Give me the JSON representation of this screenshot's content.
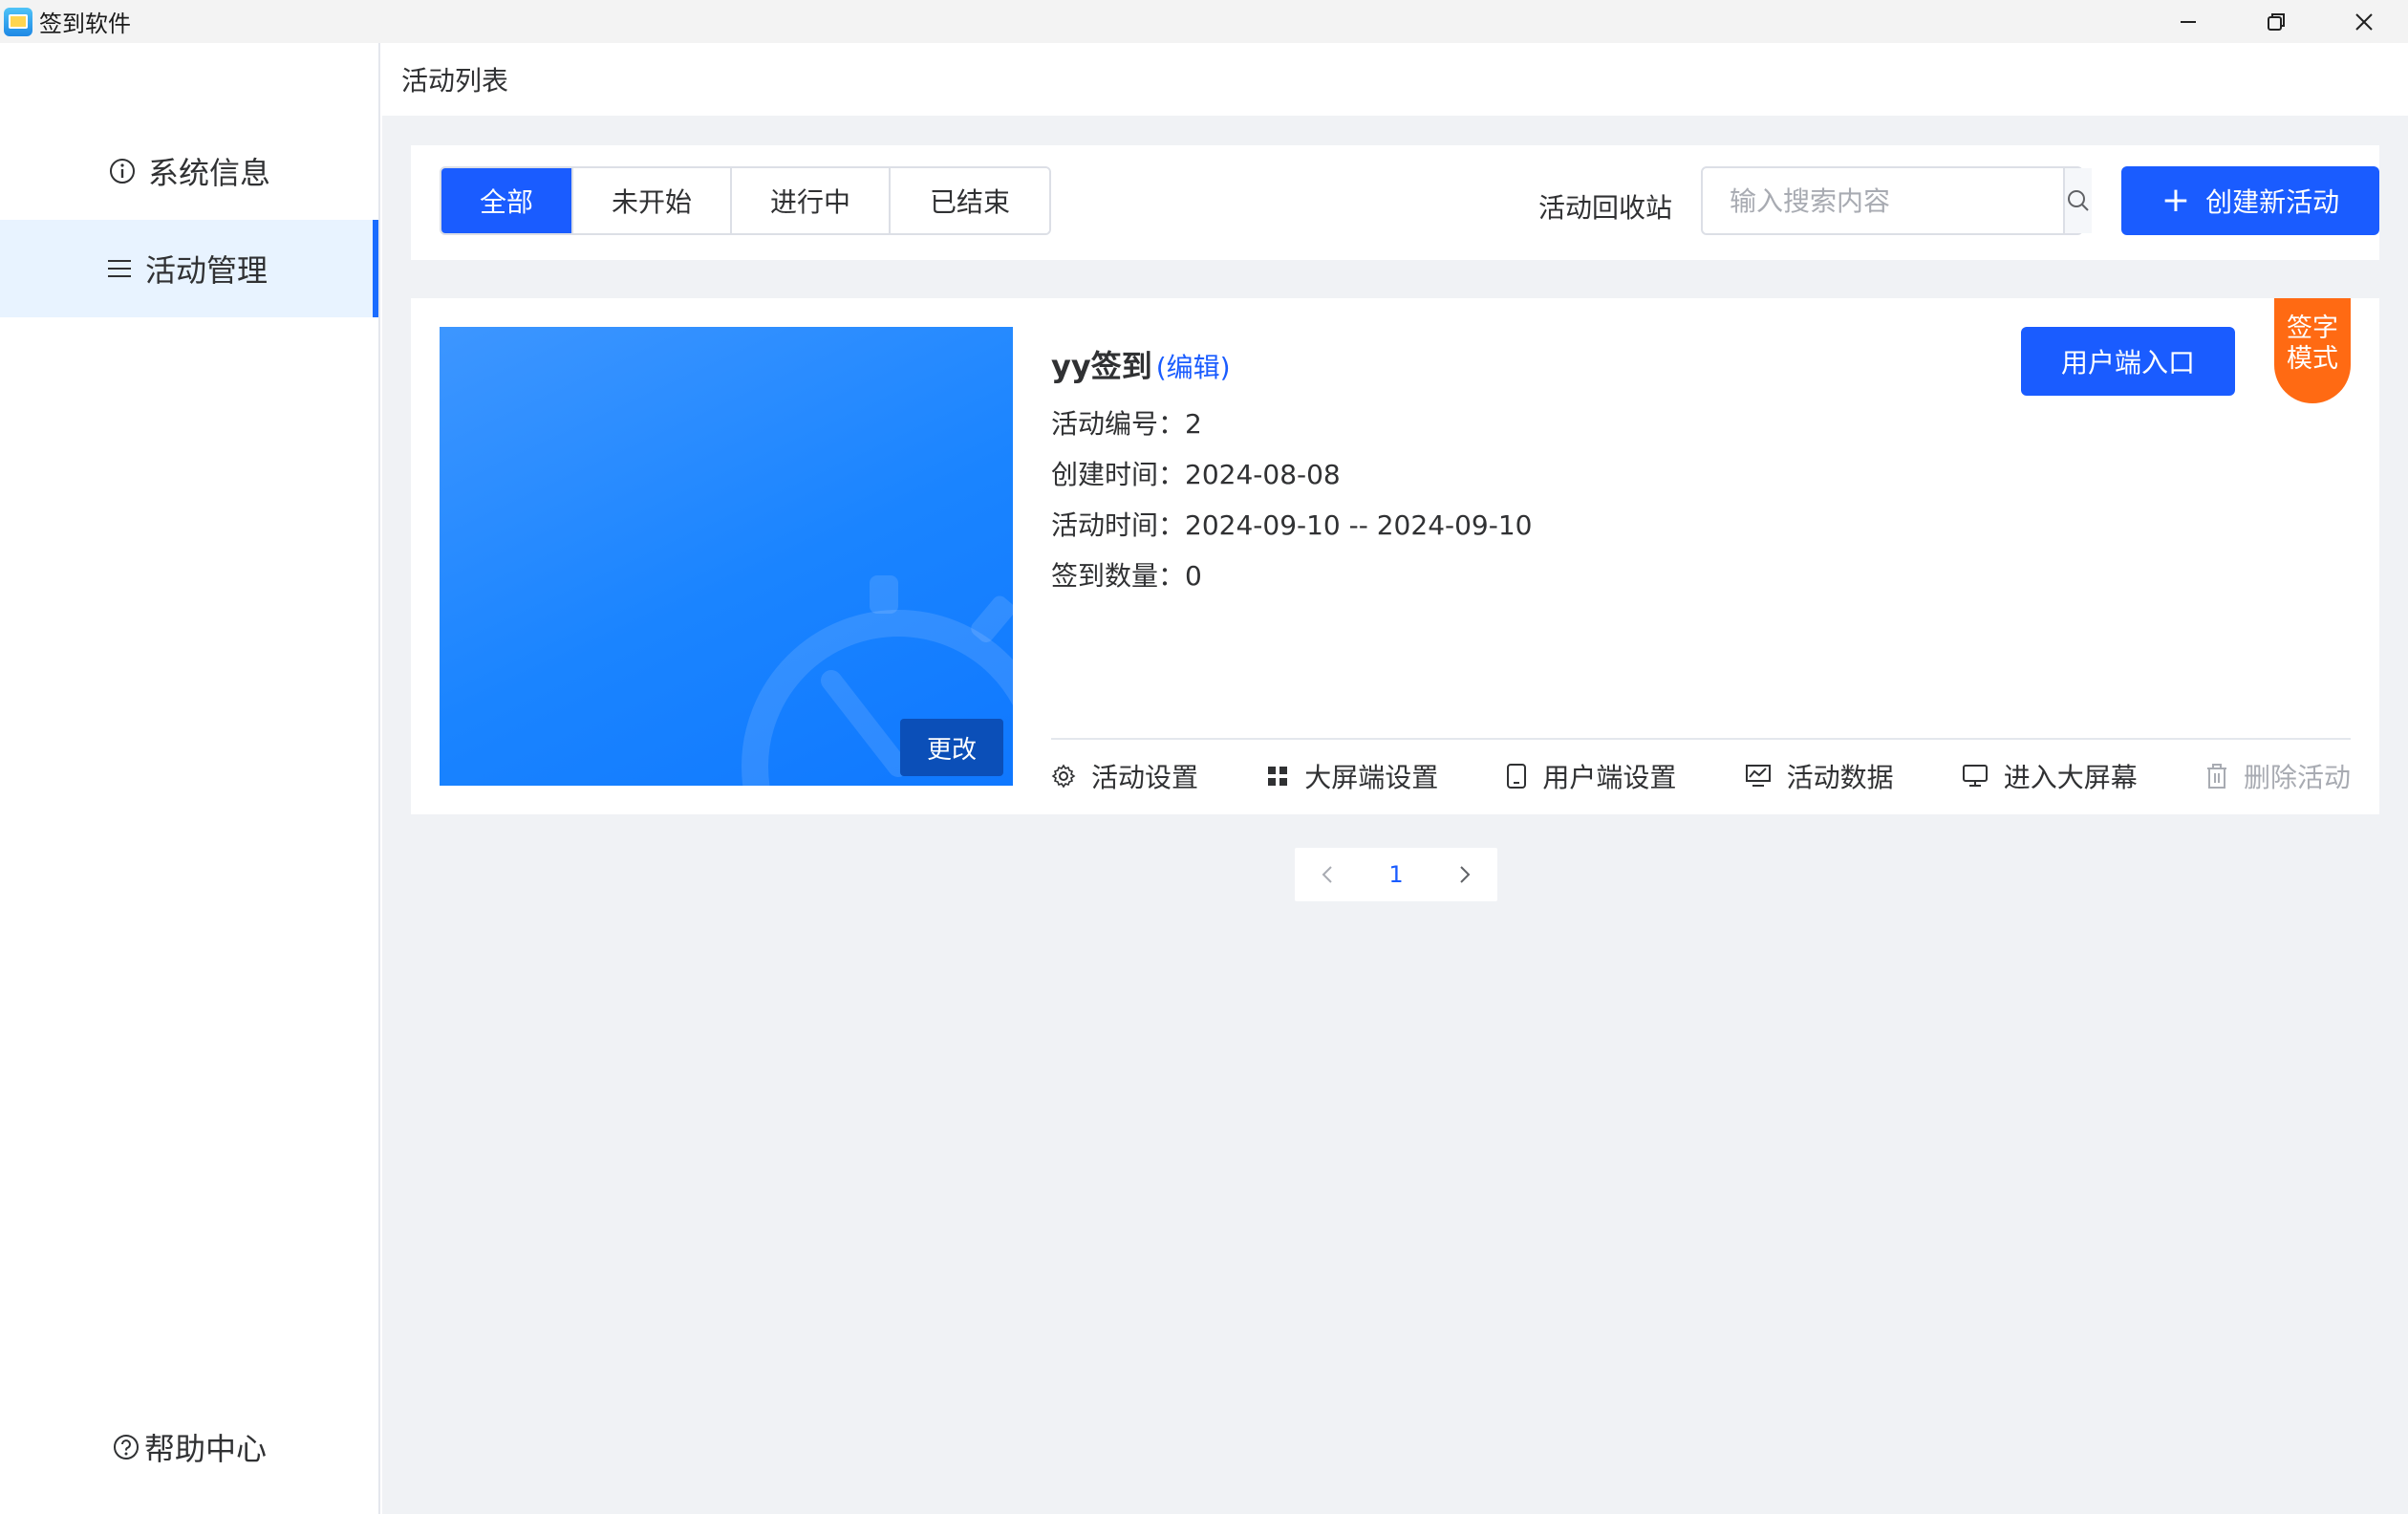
{
  "window": {
    "title": "签到软件",
    "controls": [
      "minimize-icon",
      "restore-icon",
      "close-icon"
    ]
  },
  "sidebar": {
    "items": [
      {
        "label": "系统信息",
        "icon": "info-icon",
        "active": false
      },
      {
        "label": "活动管理",
        "icon": "list-icon",
        "active": true
      }
    ],
    "help": {
      "label": "帮助中心",
      "icon": "question-icon"
    }
  },
  "breadcrumb": "活动列表",
  "toolbar": {
    "tabs": [
      {
        "label": "全部",
        "active": true
      },
      {
        "label": "未开始",
        "active": false
      },
      {
        "label": "进行中",
        "active": false
      },
      {
        "label": "已结束",
        "active": false
      }
    ],
    "recycle_label": "活动回收站",
    "search_placeholder": "输入搜索内容",
    "create_label": "创建新活动"
  },
  "activity": {
    "name": "yy签到",
    "edit_label": "(编辑)",
    "cover_change_label": "更改",
    "info": [
      {
        "label": "活动编号：",
        "value": "2"
      },
      {
        "label": "创建时间：",
        "value": "2024-08-08"
      },
      {
        "label": "活动时间：",
        "value": "2024-09-10 -- 2024-09-10"
      },
      {
        "label": "签到数量：",
        "value": "0"
      }
    ],
    "user_entry_label": "用户端入口",
    "mode_badge": [
      "签字",
      "模式"
    ],
    "actions": [
      {
        "label": "活动设置",
        "icon": "gear-icon",
        "disabled": false
      },
      {
        "label": "大屏端设置",
        "icon": "grid-icon",
        "disabled": false
      },
      {
        "label": "用户端设置",
        "icon": "phone-icon",
        "disabled": false
      },
      {
        "label": "活动数据",
        "icon": "chart-icon",
        "disabled": false
      },
      {
        "label": "进入大屏幕",
        "icon": "monitor-icon",
        "disabled": false
      },
      {
        "label": "删除活动",
        "icon": "trash-icon",
        "disabled": true
      }
    ]
  },
  "pagination": {
    "current": "1"
  },
  "colors": {
    "primary": "#1a5cff",
    "badge": "#ff6a13",
    "sidebar_active_bg": "#e8f3ff"
  }
}
